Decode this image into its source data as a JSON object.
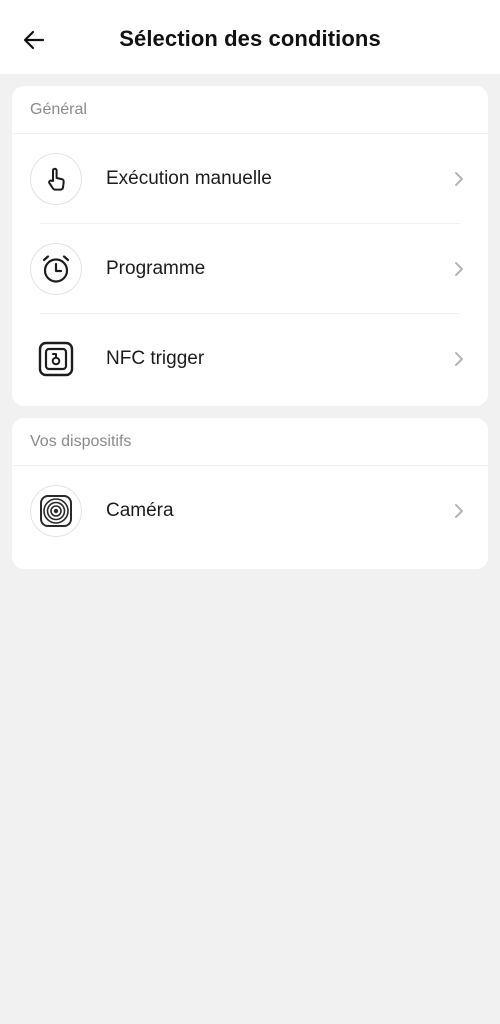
{
  "header": {
    "title": "Sélection des conditions",
    "back_icon": "arrow-left-icon"
  },
  "sections": [
    {
      "title": "Général",
      "items": [
        {
          "label": "Exécution manuelle",
          "icon": "tap-hand-icon"
        },
        {
          "label": "Programme",
          "icon": "alarm-clock-icon"
        },
        {
          "label": "NFC trigger",
          "icon": "nfc-tag-icon"
        }
      ]
    },
    {
      "title": "Vos dispositifs",
      "items": [
        {
          "label": "Caméra",
          "icon": "camera-lens-icon"
        }
      ]
    }
  ],
  "colors": {
    "background": "#f1f1f1",
    "card": "#ffffff",
    "section_title": "#8a8a8a",
    "chevron": "#b5b5b5"
  }
}
